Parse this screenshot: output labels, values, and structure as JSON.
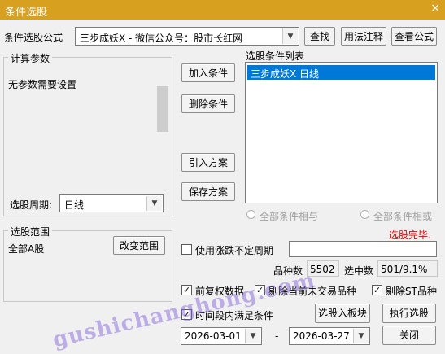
{
  "window": {
    "title": "条件选股",
    "close": "×"
  },
  "formula": {
    "label": "条件选股公式",
    "value": "三步成妖X  -  微信公众号：股市长红网",
    "buttons": {
      "find": "查找",
      "usage": "用法注释",
      "view": "查看公式"
    }
  },
  "params": {
    "group_title": "计算参数",
    "message": "无参数需要设置",
    "period_label": "选股周期:",
    "period_value": "日线"
  },
  "actions": {
    "add": "加入条件",
    "delete": "删除条件",
    "import": "引入方案",
    "save": "保存方案"
  },
  "conditions": {
    "title": "选股条件列表",
    "items": [
      "三步成妖X  日线"
    ],
    "all_and": "全部条件相与",
    "all_or": "全部条件相或",
    "status": "选股完毕."
  },
  "scope": {
    "group_title": "选股范围",
    "value": "全部A股",
    "change": "改变范围"
  },
  "options": {
    "variable_period": "使用涨跌不定周期",
    "count_label": "品种数",
    "count_value": "5502",
    "selected_label": "选中数",
    "selected_value": "501/9.1%",
    "pre_adjust": "前复权数据",
    "exclude_untraded": "剔除当前未交易品种",
    "exclude_st": "剔除ST品种",
    "time_range": "时间段内满足条件"
  },
  "bottom": {
    "to_block": "选股入板块",
    "execute": "执行选股",
    "close": "关闭",
    "date_from": "2026-03-01",
    "date_dash": "-",
    "date_to": "2026-03-27"
  },
  "watermark": "gushichanghong.com",
  "colors": {
    "titlebar": "#d7a01f",
    "selection": "#0078d7",
    "status": "#e00000"
  }
}
